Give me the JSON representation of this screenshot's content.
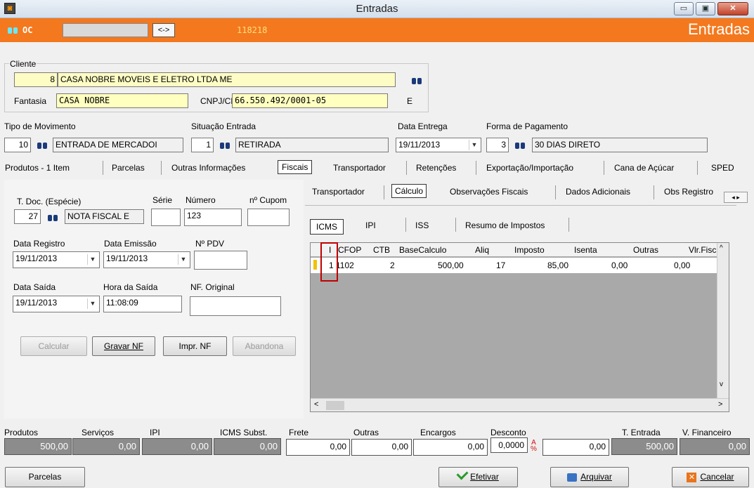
{
  "window": {
    "title": "Entradas",
    "header_title": "Entradas",
    "min": "▭",
    "max": "▣",
    "close": "✕"
  },
  "toolbar": {
    "oc_label": "OC",
    "nav_label": "<->",
    "order_number": "118218"
  },
  "client": {
    "group_label": "Cliente",
    "code": "8",
    "name": "CASA NOBRE MOVEIS E ELETRO LTDA ME",
    "fantasia_label": "Fantasia",
    "fantasia": "CASA NOBRE",
    "cnpj_label": "CNPJ/CPF",
    "cnpj": "66.550.492/0001-05",
    "type": "E"
  },
  "movement": {
    "tipo_label": "Tipo  de Movimento",
    "tipo_code": "10",
    "tipo_name": "ENTRADA DE MERCADOI",
    "situacao_label": "Situação Entrada",
    "situacao_code": "1",
    "situacao_name": "RETIRADA",
    "data_entrega_label": "Data Entrega",
    "data_entrega": "19/11/2013",
    "forma_label": "Forma de Pagamento",
    "forma_code": "3",
    "forma_name": "30 DIAS DIRETO"
  },
  "tabs": [
    "Produtos - 1 Item",
    "Parcelas",
    "Outras Informações",
    "Fiscais",
    "Transportador",
    "Retenções",
    "Exportação/Importação",
    "Cana de Açúcar",
    "SPED"
  ],
  "fiscal": {
    "tdoc_label": "T. Doc. (Espécie)",
    "tdoc_code": "27",
    "tdoc_name": "NOTA FISCAL E",
    "serie_label": "Série",
    "serie": "",
    "numero_label": "Número",
    "numero": "123",
    "cupom_label": "nº Cupom",
    "cupom": "",
    "data_registro_label": "Data Registro",
    "data_registro": "19/11/2013",
    "data_emissao_label": "Data Emissão",
    "data_emissao": "19/11/2013",
    "pdv_label": "Nº PDV",
    "pdv": "",
    "data_saida_label": "Data Saída",
    "data_saida": "19/11/2013",
    "hora_saida_label": "Hora da Saída",
    "hora_saida": "11:08:09",
    "nf_original_label": "NF. Original",
    "nf_original": ""
  },
  "actions": {
    "calcular": "Calcular",
    "gravar": "Gravar NF",
    "imprimir": "Impr. NF",
    "abandona": "Abandona"
  },
  "subtabs": [
    "Transportador",
    "Cálculo",
    "Observações Fiscais",
    "Dados Adicionais",
    "Obs Registro"
  ],
  "taxtabs": [
    "ICMS",
    "IPI",
    "ISS",
    "Resumo de Impostos"
  ],
  "grid": {
    "headers": [
      "I",
      "CFOP",
      "CTB",
      "BaseCalculo",
      "Aliq",
      "Imposto",
      "Isenta",
      "Outras",
      "Vlr.Fisc."
    ],
    "rows": [
      [
        "1",
        "1102",
        "2",
        "500,00",
        "17",
        "85,00",
        "0,00",
        "0,00",
        ""
      ]
    ]
  },
  "totals": {
    "produtos_label": "Produtos",
    "produtos": "500,00",
    "servicos_label": "Serviços",
    "servicos": "0,00",
    "ipi_label": "IPI",
    "ipi": "0,00",
    "icms_label": "ICMS Subst.",
    "icms": "0,00",
    "frete_label": "Frete",
    "frete": "0,00",
    "outras_label": "Outras",
    "outras": "0,00",
    "encargos_label": "Encargos",
    "encargos": "0,00",
    "desconto_label": "Desconto",
    "desconto_pct": "0,0000",
    "desconto": "0,00",
    "tentrada_label": "T. Entrada",
    "tentrada": "500,00",
    "vfin_label": "V. Financeiro",
    "vfin": "0,00"
  },
  "footer": {
    "parcelas": "Parcelas",
    "efetivar": "Efetivar",
    "arquivar": "Arquivar",
    "cancelar": "Cancelar"
  },
  "colors": {
    "accent": "#f4781e",
    "highlight": "#c00000"
  }
}
